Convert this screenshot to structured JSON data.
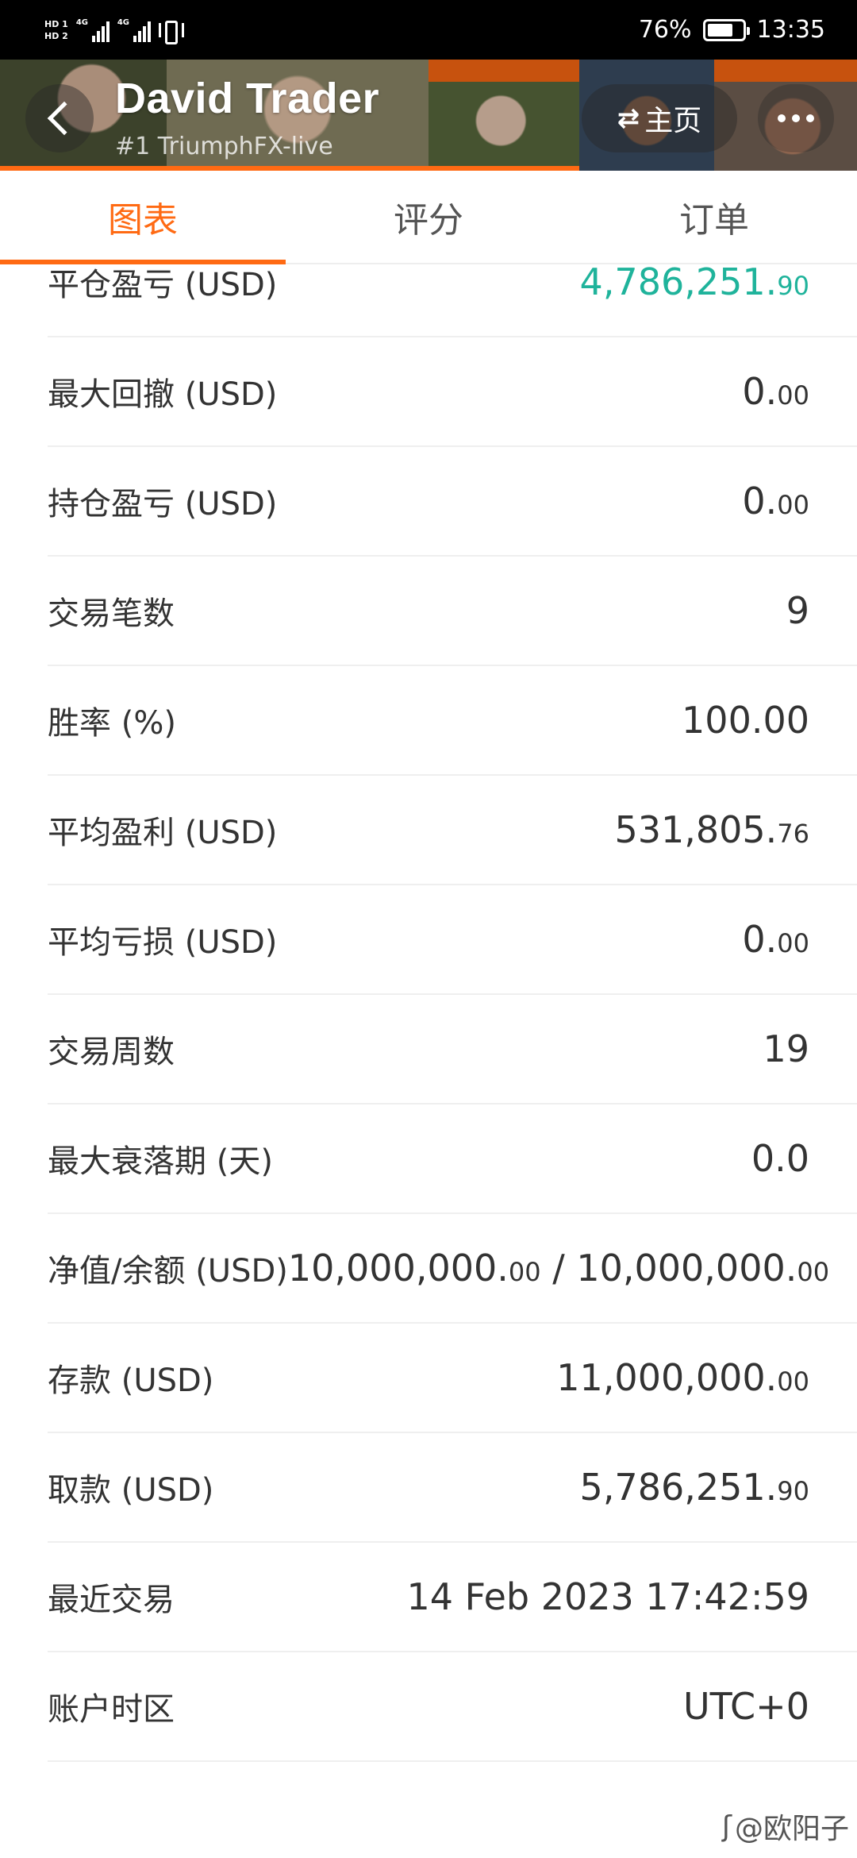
{
  "status_bar": {
    "hd1": "HD 1",
    "hd2": "HD 2",
    "net1": "4G",
    "net2": "4G",
    "battery": "76%",
    "time": "13:35",
    "battery_level": 0.76
  },
  "header": {
    "trader_name": "David Trader",
    "account": "#1  TriumphFX-live",
    "home_label": "主页"
  },
  "tabs": [
    {
      "label": "图表",
      "active": true
    },
    {
      "label": "评分",
      "active": false
    },
    {
      "label": "订单",
      "active": false
    }
  ],
  "stats": [
    {
      "label": "平仓盈亏 (USD)",
      "value_int": "4,786,251.",
      "value_dec": "90"
    },
    {
      "label": "最大回撤 (USD)",
      "value_int": "0.",
      "value_dec": "00"
    },
    {
      "label": "持仓盈亏 (USD)",
      "value_int": "0.",
      "value_dec": "00"
    },
    {
      "label": "交易笔数",
      "value_int": "9",
      "value_dec": ""
    },
    {
      "label": "胜率 (%)",
      "value_int": "100.00",
      "value_dec": ""
    },
    {
      "label": "平均盈利 (USD)",
      "value_int": "531,805.",
      "value_dec": "76"
    },
    {
      "label": "平均亏损 (USD)",
      "value_int": "0.",
      "value_dec": "00"
    },
    {
      "label": "交易周数",
      "value_int": "19",
      "value_dec": ""
    },
    {
      "label": "最大衰落期 (天)",
      "value_int": "0.0",
      "value_dec": ""
    },
    {
      "label": "净值/余额 (USD)",
      "value_a_int": "10,000,000.",
      "value_a_dec": "00",
      "separator": " / ",
      "value_b_int": "10,000,000.",
      "value_b_dec": "00"
    },
    {
      "label": "存款 (USD)",
      "value_int": "11,000,000.",
      "value_dec": "00"
    },
    {
      "label": "取款 (USD)",
      "value_int": "5,786,251.",
      "value_dec": "90"
    },
    {
      "label": "最近交易",
      "value_int": "14 Feb 2023 17:42:59",
      "value_dec": ""
    },
    {
      "label": "账户时区",
      "value_int": "UTC+0",
      "value_dec": ""
    }
  ],
  "colors": {
    "accent": "#ff6a13",
    "positive": "#1fb39b"
  },
  "watermark": "@欧阳子"
}
